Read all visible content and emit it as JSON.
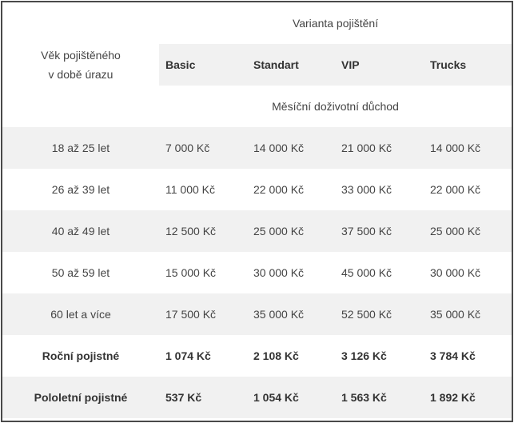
{
  "header": {
    "age_label_line1": "Věk pojištěného",
    "age_label_line2": "v době úrazu",
    "variant_label": "Varianta pojištění",
    "plans": [
      "Basic",
      "Standart",
      "VIP",
      "Trucks"
    ],
    "subheader": "Měsíční doživotní důchod"
  },
  "rows": [
    {
      "label": "18 až 25 let",
      "values": [
        "7 000 Kč",
        "14 000 Kč",
        "21 000 Kč",
        "14 000 Kč"
      ]
    },
    {
      "label": "26 až 39 let",
      "values": [
        "11 000 Kč",
        "22 000 Kč",
        "33 000 Kč",
        "22 000 Kč"
      ]
    },
    {
      "label": "40 až 49 let",
      "values": [
        "12 500 Kč",
        "25 000 Kč",
        "37 500 Kč",
        "25 000 Kč"
      ]
    },
    {
      "label": "50 až 59 let",
      "values": [
        "15 000 Kč",
        "30 000 Kč",
        "45 000 Kč",
        "30 000 Kč"
      ]
    },
    {
      "label": "60 let a více",
      "values": [
        "17 500 Kč",
        "35 000 Kč",
        "52 500 Kč",
        "35 000 Kč"
      ]
    },
    {
      "label": "Roční pojistné",
      "values": [
        "1 074 Kč",
        "2 108 Kč",
        "3 126 Kč",
        "3 784 Kč"
      ]
    },
    {
      "label": "Pololetní pojistné",
      "values": [
        "537 Kč",
        "1 054 Kč",
        "1 563 Kč",
        "1 892 Kč"
      ]
    }
  ]
}
